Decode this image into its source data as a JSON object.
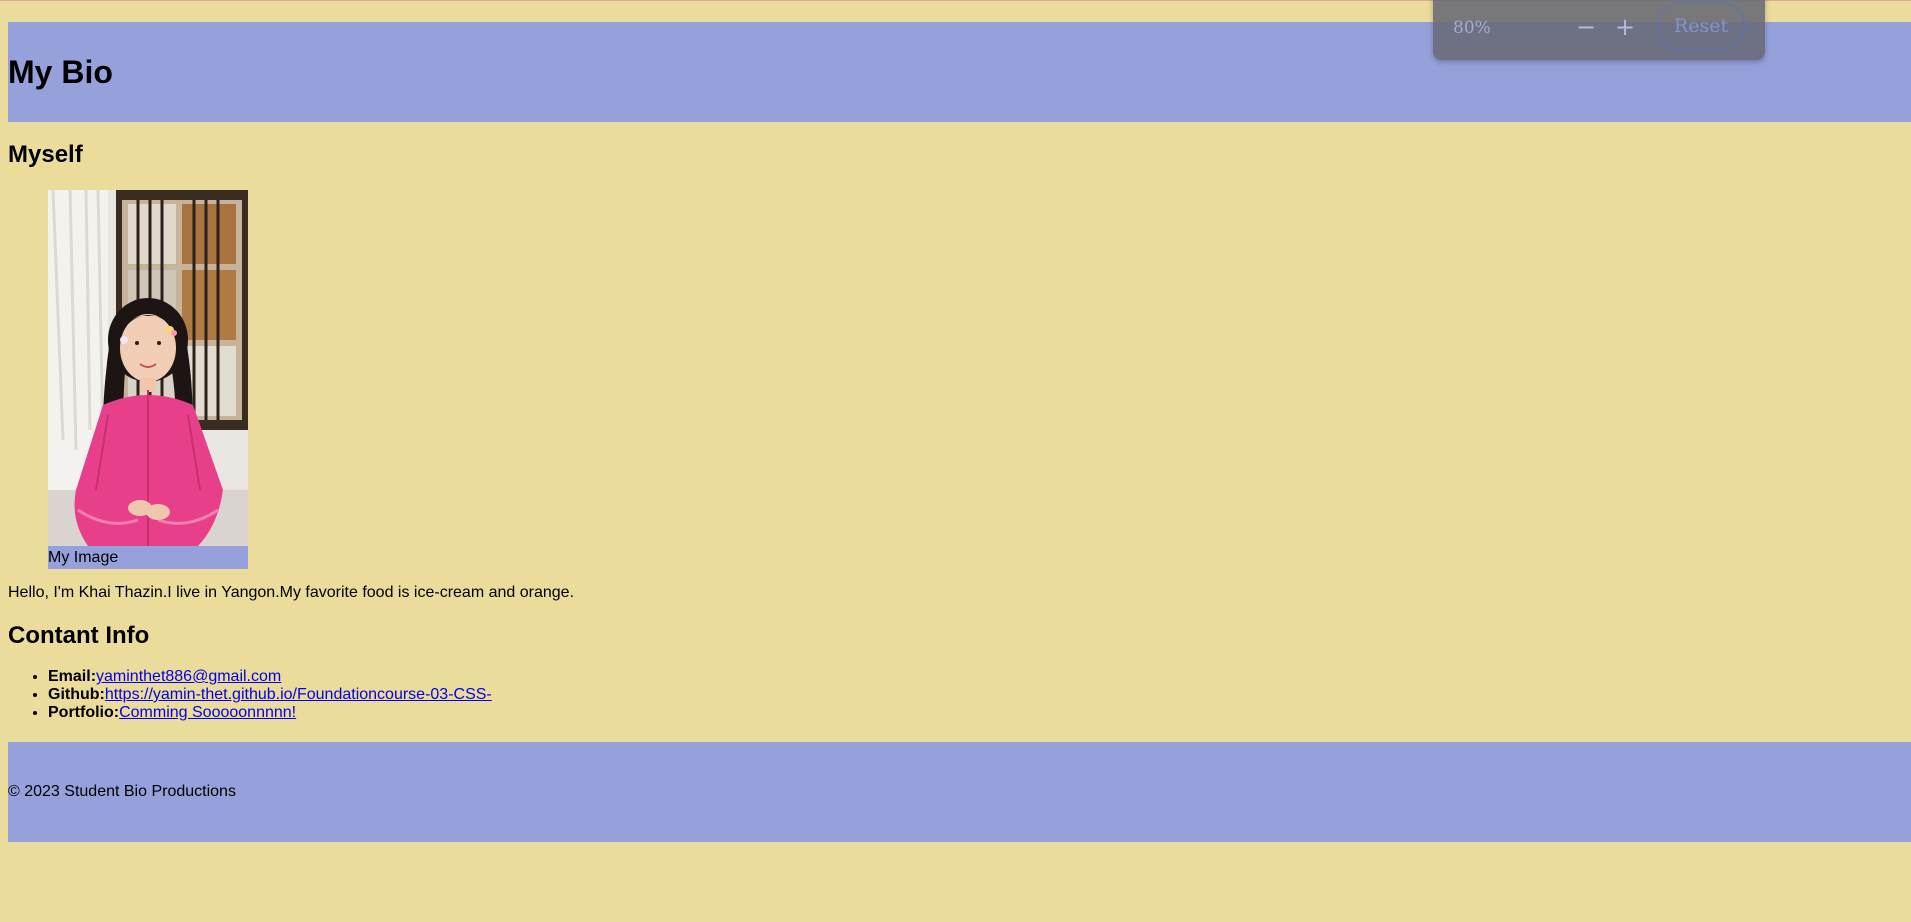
{
  "header": {
    "title": "My Bio"
  },
  "myself": {
    "heading": "Myself",
    "image_caption": "My Image",
    "bio": "Hello, I'm Khai Thazin.I live in Yangon.My favorite food is ice-cream and orange."
  },
  "contact": {
    "heading": "Contant Info",
    "items": [
      {
        "label": "Email:",
        "link": "yaminthet886@gmail.com"
      },
      {
        "label": "Github:",
        "link": "https://yamin-thet.github.io/Foundationcourse-03-CSS-"
      },
      {
        "label": "Portfolio:",
        "link": "Comming Sooooonnnnn!"
      }
    ]
  },
  "footer": {
    "text": "© 2023 Student Bio Productions"
  },
  "zoom_popup": {
    "level": "80%",
    "zoom_out_icon": "minus-icon",
    "zoom_in_icon": "plus-icon",
    "reset_label": "Reset"
  },
  "colors": {
    "page_background": "#ebdc9c",
    "header_footer_background": "#96a1dc",
    "link": "#0000ee"
  }
}
